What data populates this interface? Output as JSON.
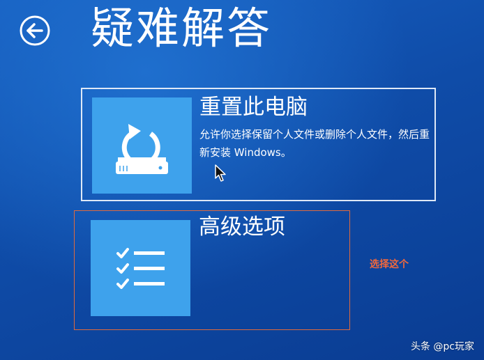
{
  "header": {
    "title": "疑难解答",
    "back_icon": "back-arrow-icon"
  },
  "options": {
    "reset": {
      "title": "重置此电脑",
      "description": "允许你选择保留个人文件或删除个人文件，然后重新安装 Windows。",
      "icon": "reset-pc-icon"
    },
    "advanced": {
      "title": "高级选项",
      "icon": "checklist-icon"
    }
  },
  "annotation": {
    "text": "选择这个",
    "color": "#f2683c"
  },
  "watermark": {
    "text": "头条 @pc玩家"
  },
  "colors": {
    "background": "#1254b4",
    "tile": "#3ea2ec",
    "highlight": "#e06a3d"
  }
}
